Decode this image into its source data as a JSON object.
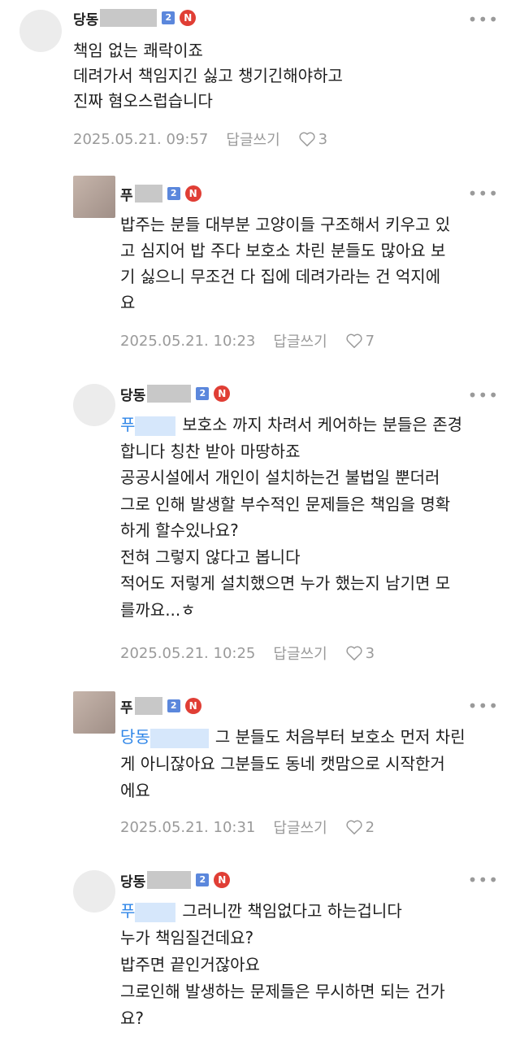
{
  "comments": [
    {
      "nick": "당동",
      "level": "2",
      "nbadge": "N",
      "lines": [
        "책임 없는 쾌락이죠",
        "데려가서 책임지긴 싫고 챙기긴해야하고",
        "진짜 혐오스럽습니다"
      ],
      "date": "2025.05.21. 09:57",
      "reply_label": "답글쓰기",
      "likes": "3"
    },
    {
      "nick": "푸",
      "level": "2",
      "nbadge": "N",
      "lines": [
        "밥주는 분들 대부분 고양이들 구조해서 키우고 있",
        "고 심지어 밥 주다 보호소 차린 분들도 많아요 보",
        "기 싫으니 무조건 다 집에 데려가라는 건 억지에",
        "요"
      ],
      "date": "2025.05.21. 10:23",
      "reply_label": "답글쓰기",
      "likes": "7"
    },
    {
      "nick": "당동",
      "level": "2",
      "nbadge": "N",
      "mention": "푸",
      "first_line": "보호소 까지 차려서 케어하는 분들은 존경",
      "lines": [
        "합니다 칭찬 받아 마땅하죠",
        "공공시설에서 개인이 설치하는건 불법일 뿐더러",
        "그로 인해 발생할 부수적인 문제들은 책임을 명확",
        "하게 할수있나요?",
        "전혀 그렇지 않다고 봅니다",
        "적어도 저렇게 설치했으면 누가 했는지 남기면 모",
        "를까요...ㅎ"
      ],
      "date": "2025.05.21. 10:25",
      "reply_label": "답글쓰기",
      "likes": "3"
    },
    {
      "nick": "푸",
      "level": "2",
      "nbadge": "N",
      "mention": "당동",
      "first_line": "그 분들도 처음부터 보호소 먼저 차린",
      "lines": [
        "게 아니잖아요 그분들도 동네 캣맘으로 시작한거",
        "에요"
      ],
      "date": "2025.05.21. 10:31",
      "reply_label": "답글쓰기",
      "likes": "2"
    },
    {
      "nick": "당동",
      "level": "2",
      "nbadge": "N",
      "mention": "푸",
      "first_line": "그러니깐 책임없다고 하는겁니다",
      "lines": [
        "누가 책임질건데요?",
        "밥주면 끝인거잖아요",
        "그로인해 발생하는 문제들은 무시하면 되는 건가",
        "요?"
      ]
    }
  ]
}
